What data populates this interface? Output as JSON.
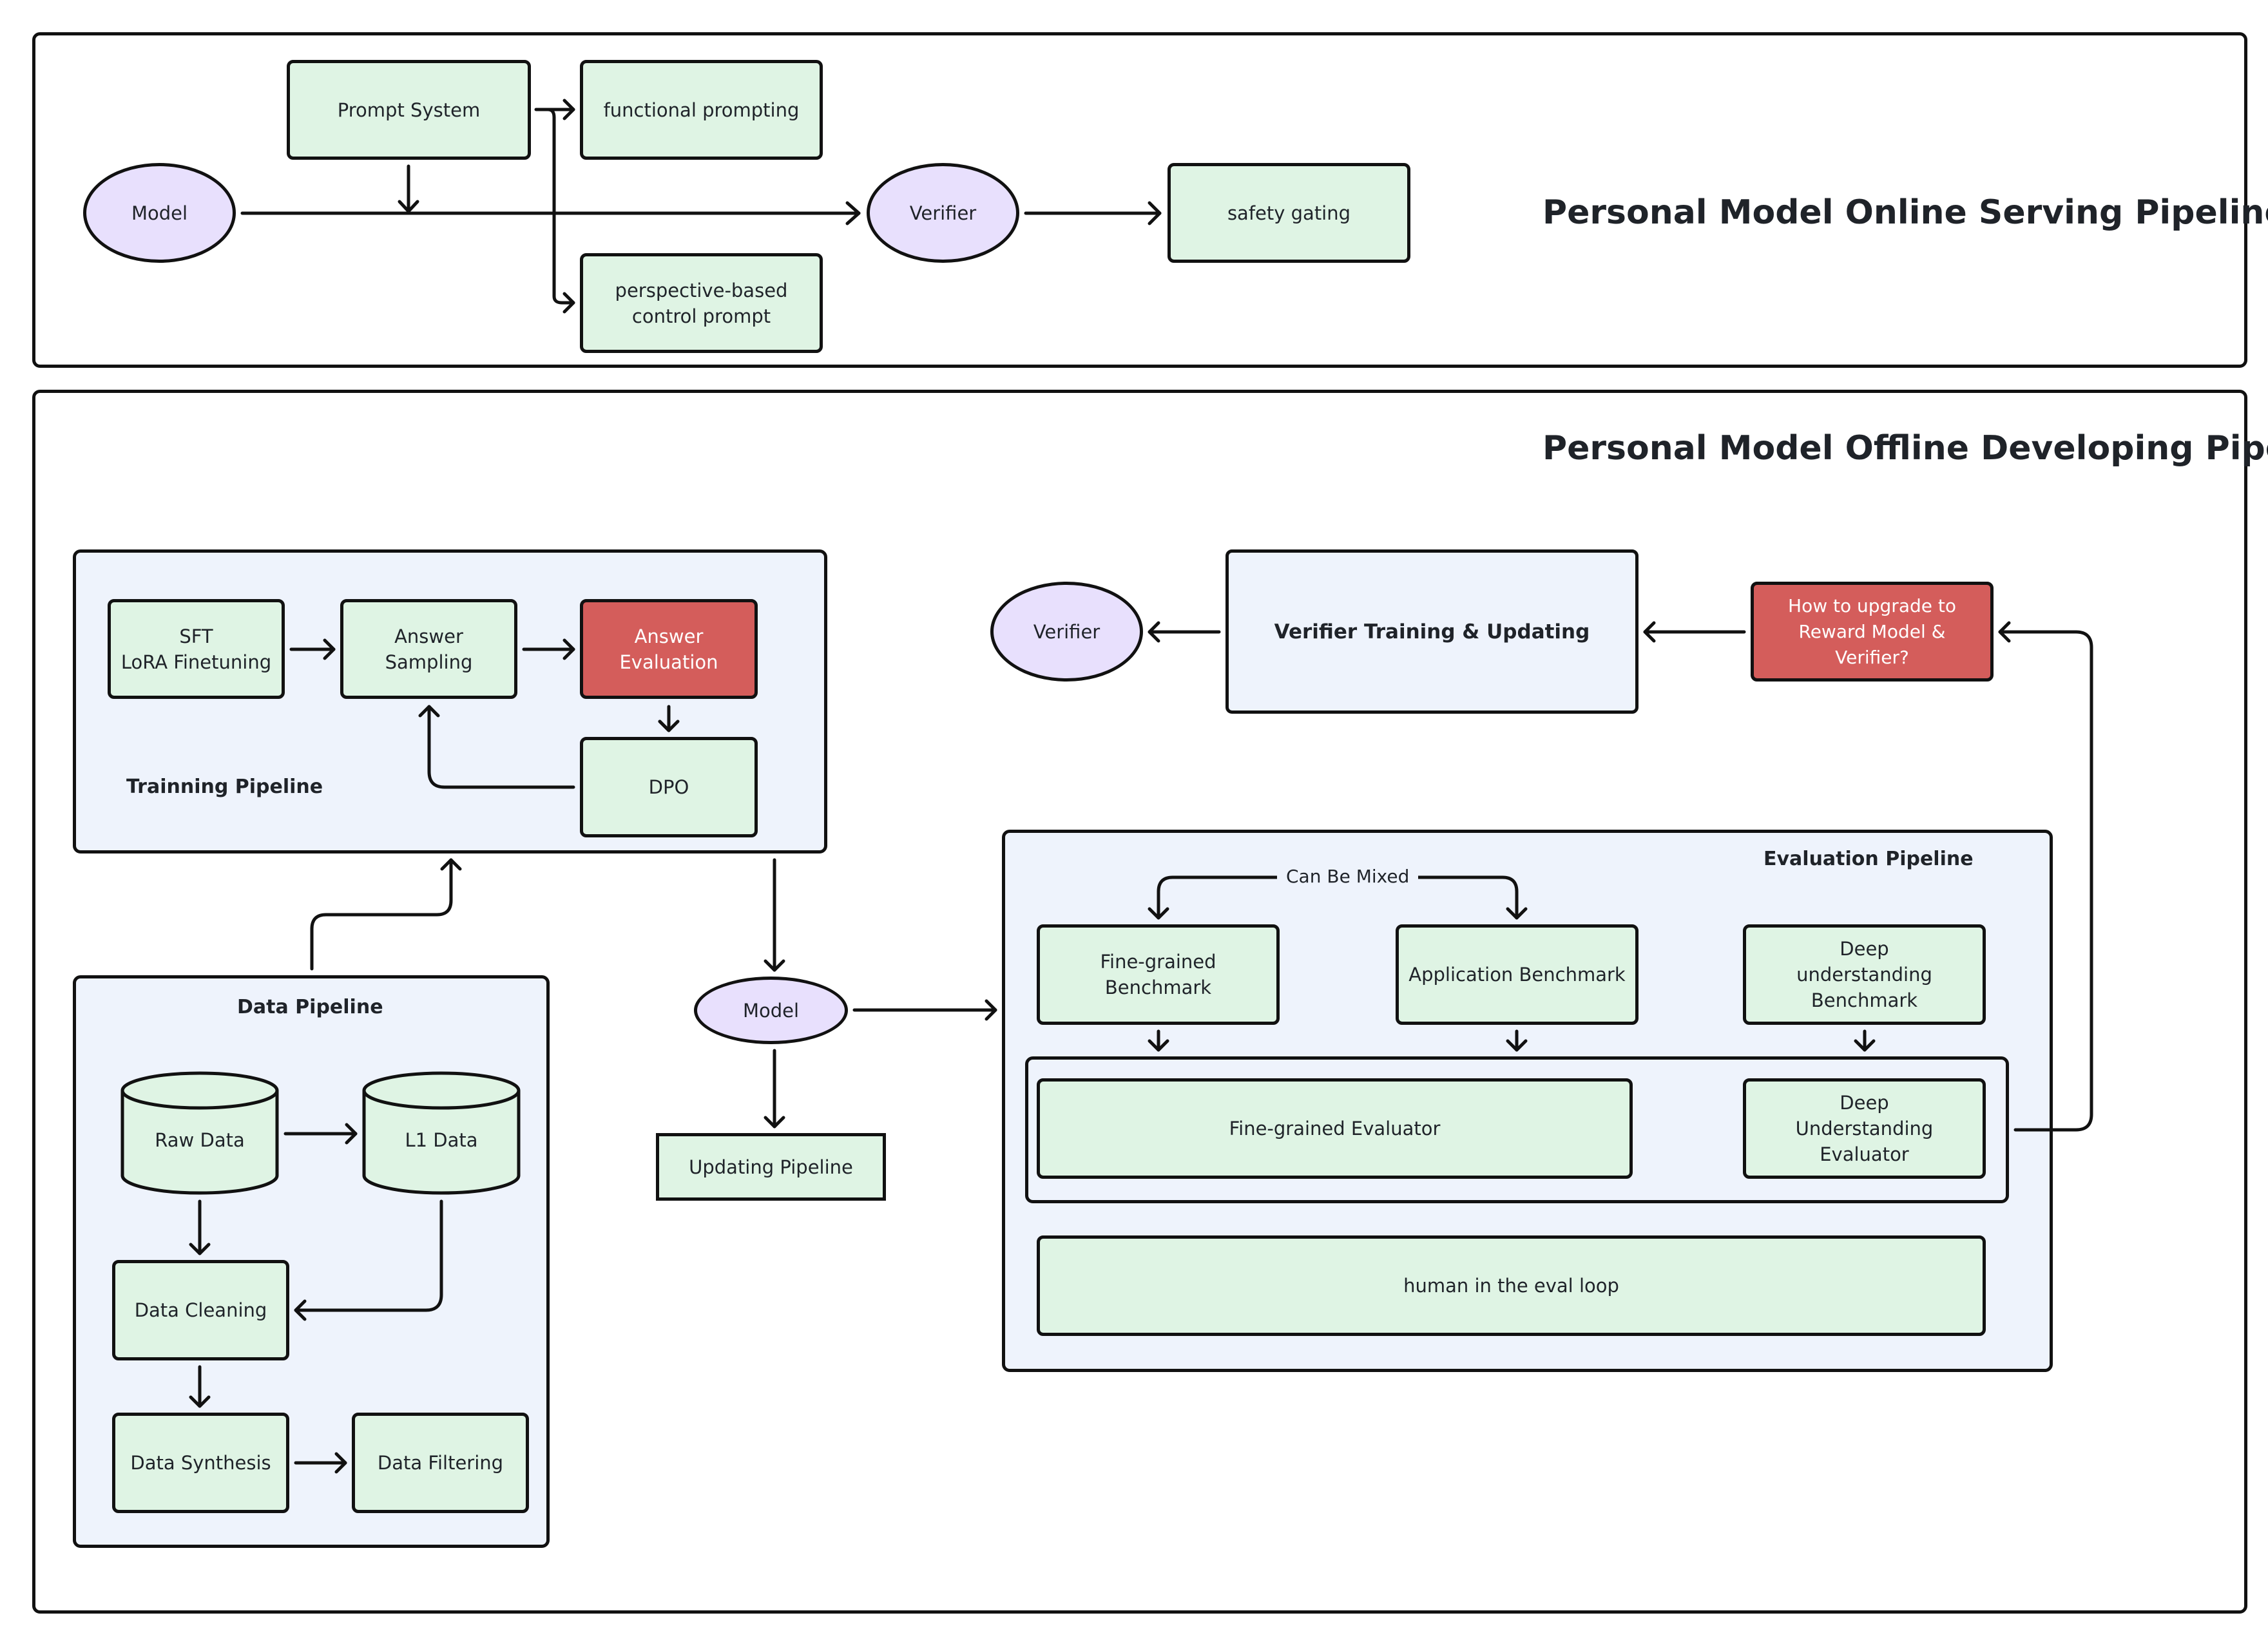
{
  "online": {
    "title": "Personal Model Online Serving Pipeline",
    "model": "Model",
    "prompt_system": "Prompt System",
    "functional_prompting": "functional prompting",
    "perspective_prompt": "perspective-based control prompt",
    "verifier": "Verifier",
    "safety_gating": "safety gating"
  },
  "offline": {
    "title": "Personal Model Offline Developing Pipeline",
    "training": {
      "label": "Trainning Pipeline",
      "sft_line1": "SFT",
      "sft_line2": "LoRA Finetuning",
      "answer_sampling": "Answer Sampling",
      "answer_evaluation": "Answer Evaluation",
      "dpo": "DPO"
    },
    "verifier": "Verifier",
    "verifier_training": "Verifier Training & Updating",
    "upgrade_question": "How to upgrade to Reward Model & Verifier?",
    "data": {
      "label": "Data Pipeline",
      "raw_data": "Raw Data",
      "l1_data": "L1 Data",
      "cleaning": "Data Cleaning",
      "synthesis": "Data Synthesis",
      "filtering": "Data Filtering"
    },
    "model": "Model",
    "updating_pipeline": "Updating Pipeline",
    "evaluation": {
      "label": "Evaluation Pipeline",
      "can_be_mixed": "Can Be Mixed",
      "fine_benchmark": "Fine-grained Benchmark",
      "app_benchmark": "Application Benchmark",
      "deep_benchmark": "Deep understanding Benchmark",
      "fine_evaluator": "Fine-grained Evaluator",
      "deep_evaluator": "Deep Understanding Evaluator",
      "human_loop": "human in the eval loop"
    }
  },
  "colors": {
    "node_green": "#dff4e4",
    "node_red": "#d45d5b",
    "node_purple": "#e8e0fd",
    "panel_blue": "#eef3fc"
  }
}
